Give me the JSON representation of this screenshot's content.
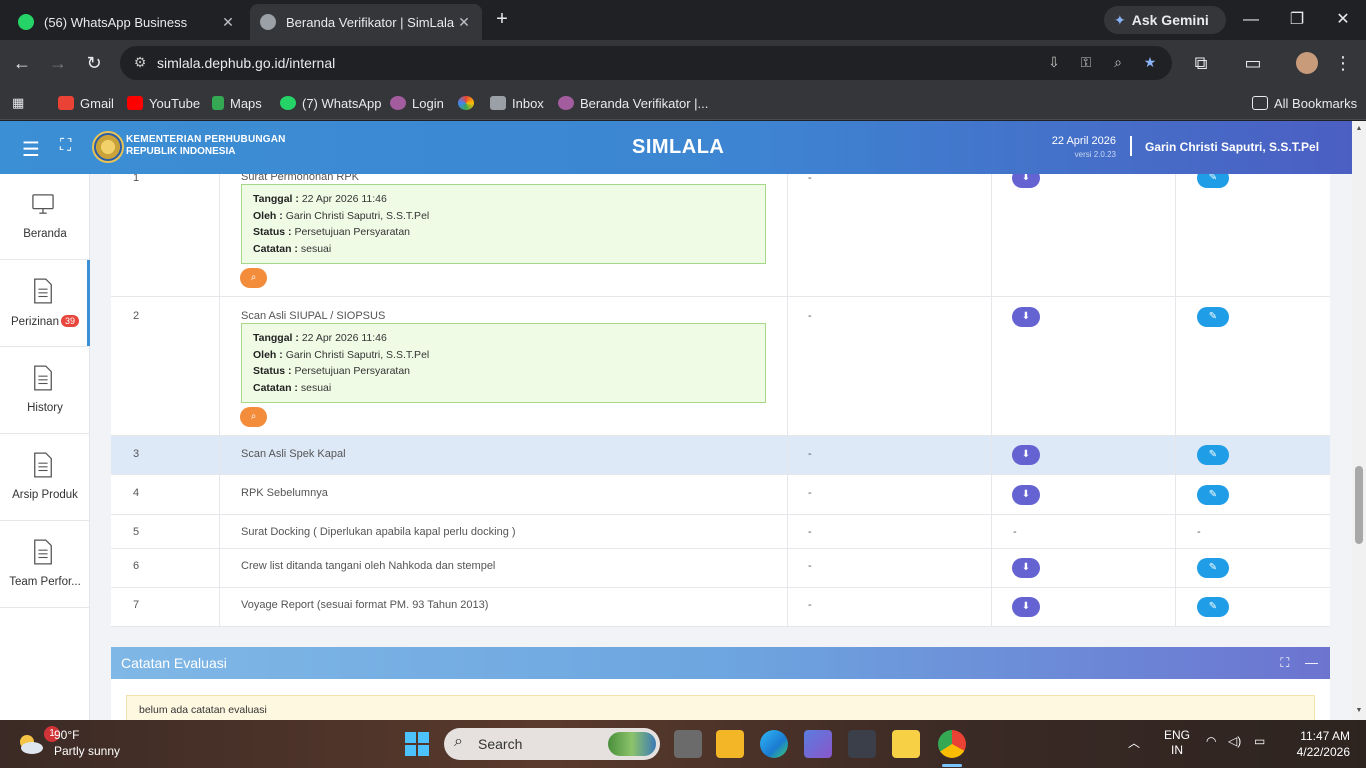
{
  "browser": {
    "tabs": [
      {
        "title": "(56) WhatsApp Business",
        "active": false
      },
      {
        "title": "Beranda Verifikator | SimLala",
        "active": true
      }
    ],
    "new_tab": "+",
    "gemini_label": "Ask Gemini",
    "url": "simlala.dephub.go.id/internal",
    "bookmarks": [
      "Gmail",
      "YouTube",
      "Maps",
      "(7) WhatsApp",
      "Login",
      "Inbox",
      "Beranda Verifikator |..."
    ],
    "all_bookmarks": "All Bookmarks"
  },
  "app": {
    "ministry_line1": "KEMENTERIAN PERHUBUNGAN",
    "ministry_line2": "REPUBLIK INDONESIA",
    "title": "SIMLALA",
    "date": "22 April 2026",
    "version": "versi 2.0.23",
    "user": "Garin Christi Saputri, S.S.T.Pel"
  },
  "sidebar": {
    "items": [
      {
        "label": "Beranda"
      },
      {
        "label": "Perizinan",
        "badge": "39"
      },
      {
        "label": "History"
      },
      {
        "label": "Arsip Produk"
      },
      {
        "label": "Team Perfor..."
      }
    ]
  },
  "labels": {
    "tanggal": "Tanggal :",
    "oleh": "Oleh :",
    "status": "Status :",
    "catatan": "Catatan :"
  },
  "table": {
    "rows": [
      {
        "no": "1",
        "name": "Surat Permohonan RPK",
        "col3": "-",
        "tanggal": "22 Apr 2026 11:46",
        "oleh": "Garin Christi Saputri, S.S.T.Pel",
        "status": "Persetujuan Persyaratan",
        "catatan": "sesuai"
      },
      {
        "no": "2",
        "name": "Scan Asli SIUPAL / SIOPSUS",
        "col3": "-",
        "tanggal": "22 Apr 2026 11:46",
        "oleh": "Garin Christi Saputri, S.S.T.Pel",
        "status": "Persetujuan Persyaratan",
        "catatan": "sesuai"
      },
      {
        "no": "3",
        "name": "Scan Asli Spek Kapal",
        "col3": "-"
      },
      {
        "no": "4",
        "name": "RPK Sebelumnya",
        "col3": "-"
      },
      {
        "no": "5",
        "name": "Surat Docking ( Diperlukan apabila kapal perlu docking )",
        "col3": "-",
        "col4": "-",
        "col5": "-"
      },
      {
        "no": "6",
        "name": "Crew list ditanda tangani oleh Nahkoda dan stempel",
        "col3": "-"
      },
      {
        "no": "7",
        "name": "Voyage Report (sesuai format PM. 93 Tahun 2013)",
        "col3": "-"
      }
    ]
  },
  "evaluasi": {
    "title": "Catatan Evaluasi",
    "note": "belum ada catatan evaluasi"
  },
  "taskbar": {
    "weather_temp": "90°F",
    "weather_desc": "Partly sunny",
    "weather_notif": "1",
    "search_placeholder": "Search",
    "lang1": "ENG",
    "lang2": "IN",
    "time": "11:47 AM",
    "date": "4/22/2026"
  },
  "colors": {
    "header_blue": "#3b8fd4",
    "download_btn": "#6563d2",
    "edit_btn": "#1f9de6",
    "zoom_btn": "#f38d3c",
    "badge_red": "#e8453c"
  }
}
